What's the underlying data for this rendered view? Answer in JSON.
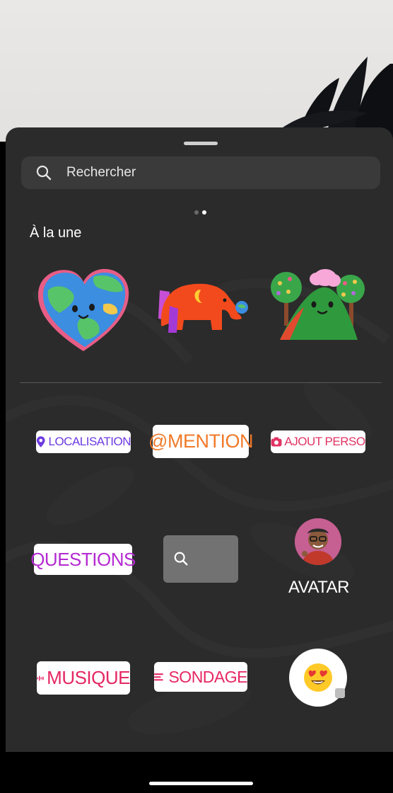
{
  "search": {
    "placeholder": "Rechercher",
    "icon": "search-icon"
  },
  "pager": {
    "pages": 2,
    "active_index": 1
  },
  "featured": {
    "title": "À la une",
    "items": [
      {
        "name": "earth-heart-sticker",
        "icon": "earth-heart-sticker-icon"
      },
      {
        "name": "elephant-sticker",
        "icon": "elephant-sticker-icon"
      },
      {
        "name": "mountain-trees-sticker",
        "icon": "mountain-trees-sticker-icon"
      }
    ]
  },
  "stickers": {
    "location": {
      "label": "LOCALISATION",
      "icon": "location-pin-icon",
      "color": "#6d3ae0"
    },
    "mention": {
      "label": "MENTION",
      "icon_text": "@",
      "color": "#f07a2a"
    },
    "add_yours": {
      "label": "AJOUT PERSO",
      "icon": "camera-icon",
      "color": "#e03464"
    },
    "questions": {
      "label": "QUESTIONS",
      "color": "#b42bd1"
    },
    "gif_search": {
      "icon": "search-icon"
    },
    "avatar": {
      "label": "AVATAR"
    },
    "music": {
      "label": "MUSIQUE",
      "icon": "music-waveform-icon",
      "color": "#e52763"
    },
    "poll": {
      "label": "SONDAGE",
      "icon": "poll-lines-icon",
      "color": "#e52763"
    },
    "emoji_slider": {
      "icon": "heart-eyes-emoji-icon"
    }
  }
}
